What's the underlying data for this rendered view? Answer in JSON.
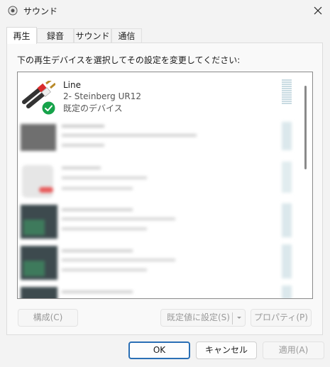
{
  "window": {
    "title": "サウンド"
  },
  "tabs": [
    {
      "label": "再生",
      "active": true
    },
    {
      "label": "録音"
    },
    {
      "label": "サウンド"
    },
    {
      "label": "通信"
    }
  ],
  "instruction": "下の再生デバイスを選択してその設定を変更してください:",
  "devices": [
    {
      "name": "Line",
      "sub1": "2- Steinberg UR12",
      "sub2": "既定のデバイス",
      "status_icon": "check-icon"
    }
  ],
  "buttons": {
    "configure": "構成(C)",
    "set_default": "既定値に設定(S)",
    "properties": "プロパティ(P)",
    "ok": "OK",
    "cancel": "キャンセル",
    "apply": "適用(A)"
  },
  "colors": {
    "check_green": "#16a34a",
    "default_button_border": "#2a6fb5"
  }
}
